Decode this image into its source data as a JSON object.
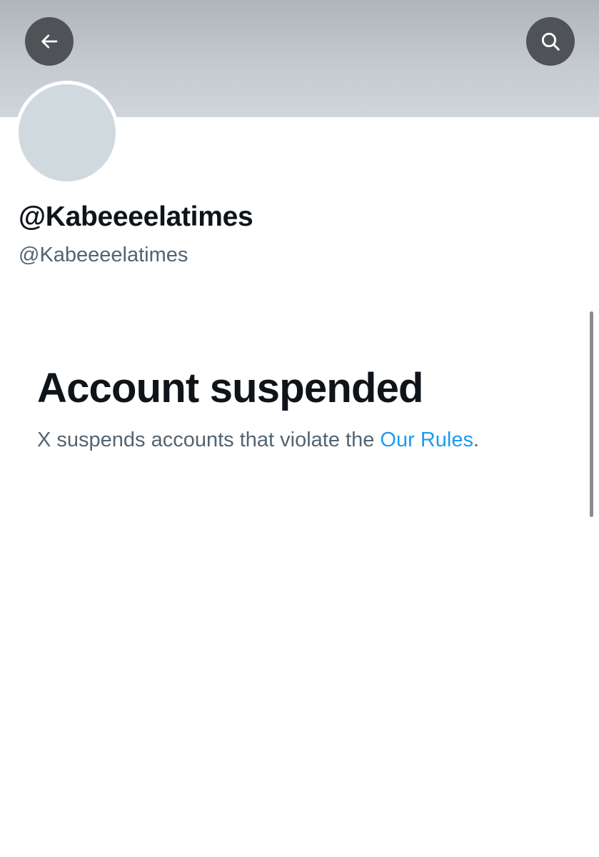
{
  "header": {
    "back_icon": "arrow-left-icon",
    "search_icon": "search-icon",
    "banner_color": "#c4cacf",
    "button_color": "#4f5256"
  },
  "profile": {
    "display_name": "@Kabeeeelatimes",
    "handle": "@Kabeeeelatimes",
    "avatar_color": "#cfd9de"
  },
  "notice": {
    "title": "Account suspended",
    "text_before_link": "X suspends accounts that violate the ",
    "link_label": "Our Rules",
    "text_after_link": ".",
    "link_color": "#1d9bf0"
  }
}
